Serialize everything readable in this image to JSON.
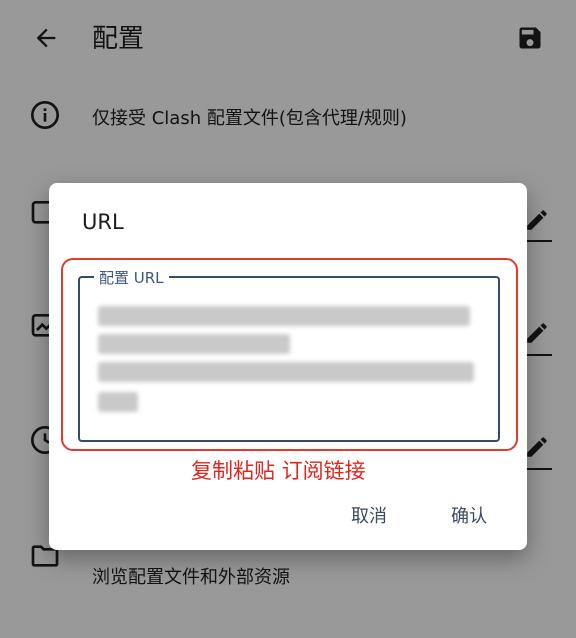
{
  "appbar": {
    "title": "配置",
    "back_icon": "arrow-left-icon",
    "save_icon": "save-icon"
  },
  "rows": [
    {
      "icon": "info-icon",
      "text": "仅接受 Clash 配置文件(包含代理/规则)"
    },
    {
      "icon": "folder-icon",
      "text": "浏览配置文件和外部资源"
    }
  ],
  "dialog": {
    "title": "URL",
    "field_label": "配置 URL",
    "annotation": "复制粘贴 订阅链接",
    "cancel_label": "取消",
    "confirm_label": "确认"
  },
  "colors": {
    "annotation": "#e0261d",
    "field_border": "#334c6d",
    "scrim": "rgba(0,0,0,0.4)"
  }
}
